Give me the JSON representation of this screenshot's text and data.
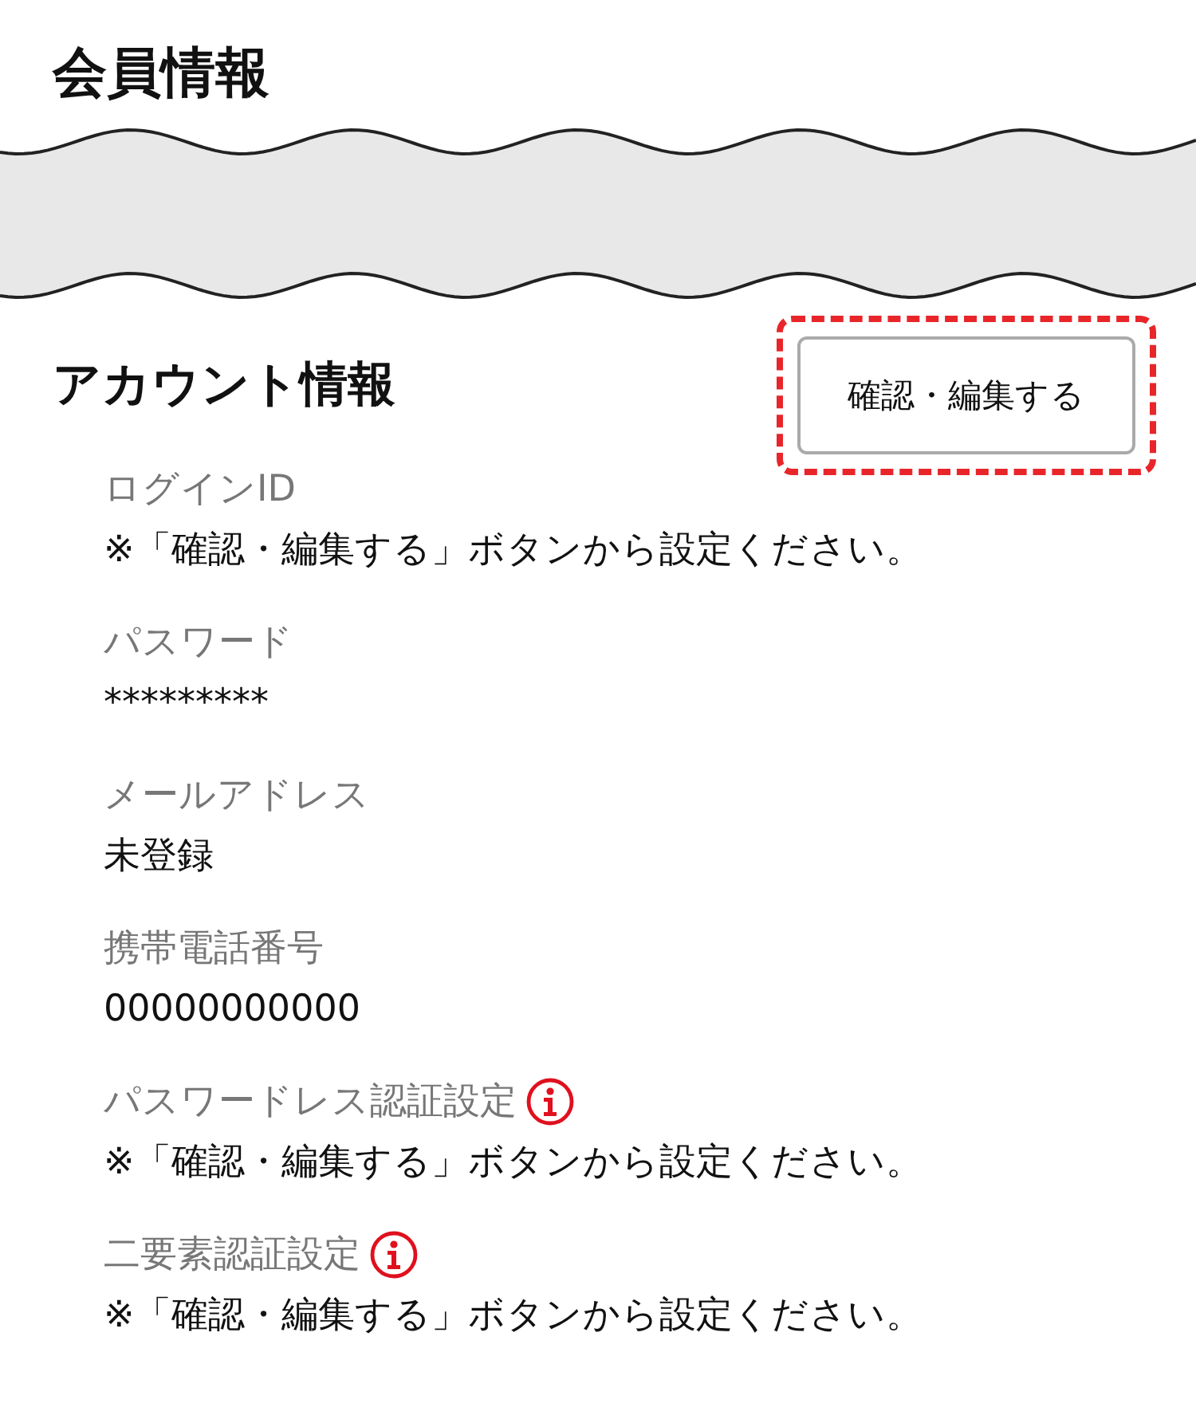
{
  "page_title": "会員情報",
  "section": {
    "title": "アカウント情報",
    "edit_button": "確認・編集する",
    "edit_highlighted": true
  },
  "fields": [
    {
      "label": "ログインID",
      "value": "※「確認・編集する」ボタンから設定ください。",
      "info": false
    },
    {
      "label": "パスワード",
      "value": "*********",
      "info": false
    },
    {
      "label": "メールアドレス",
      "value": "未登録",
      "info": false
    },
    {
      "label": "携帯電話番号",
      "value": "00000000000",
      "info": false
    },
    {
      "label": "パスワードレス認証設定",
      "value": "※「確認・編集する」ボタンから設定ください。",
      "info": true
    },
    {
      "label": "二要素認証設定",
      "value": "※「確認・編集する」ボタンから設定ください。",
      "info": true
    }
  ]
}
